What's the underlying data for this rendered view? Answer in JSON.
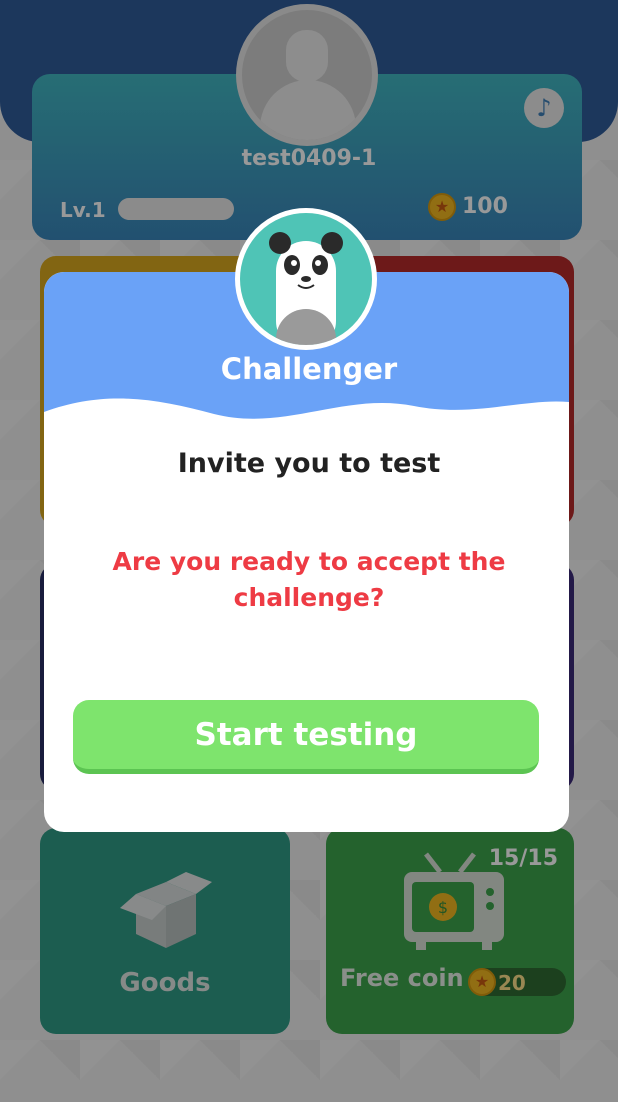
{
  "profile": {
    "username": "test0409-1",
    "level_label": "Lv.1",
    "coins": "100",
    "music_icon": "music-note-icon"
  },
  "tiles": {
    "goods_label": "Goods",
    "free_coin_label": "Free coin",
    "free_coin_count": "15/15",
    "free_coin_amount": "20"
  },
  "modal": {
    "title": "Challenger",
    "invite_text": "Invite you to test",
    "question": "Are you ready to accept the challenge?",
    "start_button_label": "Start testing"
  },
  "colors": {
    "header_blue": "#6aa2f7",
    "start_green": "#7ee46d",
    "question_red": "#ee3b44",
    "top_bar_navy": "#2f5c9a"
  }
}
